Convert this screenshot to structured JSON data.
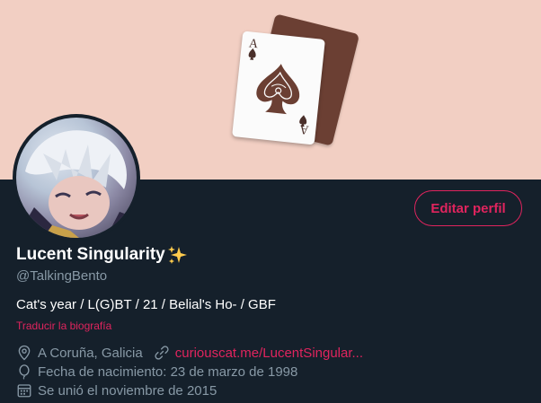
{
  "profile": {
    "name": "Lucent Singularity",
    "name_emoji": "sparkles-emoji",
    "handle": "@TalkingBento",
    "bio": "Cat's year / L(G)BT / 21 / Belial's Ho- / GBF",
    "translate_label": "Traducir la biografía",
    "location": "A Coruña, Galicia",
    "website": "curiouscat.me/LucentSingular...",
    "birthday": "Fecha de nacimiento: 23 de marzo de 1998",
    "joined": "Se unió el noviembre de 2015"
  },
  "actions": {
    "edit_profile_label": "Editar perfil"
  },
  "banner": {
    "card_rank": "A",
    "card_suit": "spade"
  },
  "colors": {
    "background": "#15202b",
    "accent": "#e0245e",
    "secondary_text": "#8899a6",
    "banner_bg": "#f2cfc3"
  },
  "icons": {
    "location": "location-pin-icon",
    "link": "link-icon",
    "birthday": "balloon-icon",
    "joined": "calendar-icon"
  }
}
